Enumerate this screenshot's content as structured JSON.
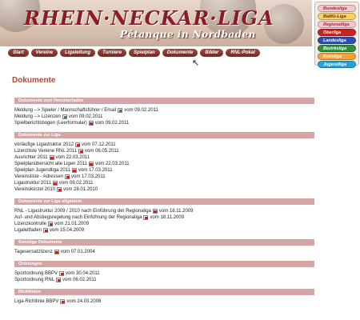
{
  "header": {
    "title": "RHEIN·NECKAR·LIGA",
    "subtitle": "Pétanque in Nordbaden"
  },
  "nav": [
    "Start",
    "Vereine",
    "Ligaleitung",
    "Turniere",
    "Spielplan",
    "Dokumente",
    "Bilder",
    "RNL-Pokal"
  ],
  "leagues": [
    {
      "label": "Bundesliga",
      "bg": "#f3c9cf",
      "color": "#b0243c"
    },
    {
      "label": "BaWü-Liga",
      "bg": "#f0d46a",
      "color": "#7a1b16"
    },
    {
      "label": "Regionalliga",
      "bg": "#f3c9cf",
      "color": "#b0243c"
    },
    {
      "label": "Oberliga",
      "bg": "#c9231f",
      "color": "#ffffff"
    },
    {
      "label": "Landesliga",
      "bg": "#2f4fb0",
      "color": "#ffffff"
    },
    {
      "label": "Bezirksliga",
      "bg": "#2f8f3a",
      "color": "#ffffff"
    },
    {
      "label": "Kreisliga",
      "bg": "#f3a33a",
      "color": "#ffffff"
    },
    {
      "label": "Jugendliga",
      "bg": "#2aa0d8",
      "color": "#ffffff"
    }
  ],
  "page_title": "Dokumente",
  "sections": [
    {
      "title": "Dokumente zum Herunterladen",
      "rows": [
        {
          "label": "Meldung --> Spieler / Mannschaftsführer / Email",
          "icon": "excel",
          "date": "vom 09.02.2011"
        },
        {
          "label": "Meldung --> Lizenzen",
          "icon": "excel",
          "date": "vom 09.02.2011"
        },
        {
          "label": "Spielberichtsbogen (Leerformular)",
          "icon": "pdf",
          "date": "vom 09.02.2011"
        }
      ]
    },
    {
      "title": "Dokumente zur Liga",
      "rows": [
        {
          "label": "vorläufige Ligastruktur 2012",
          "icon": "pdf",
          "date": "vom 07.12.2011"
        },
        {
          "label": "Lizenzliste Vereine RNL 2011",
          "icon": "pdf",
          "date": "vom 06.05.2011"
        },
        {
          "label": "Ausrichter 2011",
          "icon": "pdf",
          "date": "vom 22.03.2011"
        },
        {
          "label": "Spielplanübersicht alle Ligen 2011",
          "icon": "pdf",
          "date": "vom 22.03.2011"
        },
        {
          "label": "Spielplan Jugendliga 2011",
          "icon": "pdf",
          "date": "vom 17.03.2011"
        },
        {
          "label": "Vereinsliste - Adressen",
          "icon": "pdf",
          "date": "vom 17.03.2011"
        },
        {
          "label": "Ligastruktur 2011",
          "icon": "pdf",
          "date": "vom 09.02.2011"
        },
        {
          "label": "Vereinskürzel 2010",
          "icon": "pdf",
          "date": "vom 28.01.2010"
        }
      ]
    },
    {
      "title": "Dokumente zur Liga allgemein",
      "rows": [
        {
          "label": "RNL - Ligastruktur 2009 / 2010 nach Einführung der Regionaliga",
          "icon": "pdf",
          "date": "vom 18.11.2009"
        },
        {
          "label": "Auf- und Abstiegsregelung nach Einführung der Regionaliga",
          "icon": "pdf",
          "date": "vom 18.11.2009"
        },
        {
          "label": "Lizenzkontrolle",
          "icon": "pdf",
          "date": "vom 21.01.2009"
        },
        {
          "label": "Ligaleitfaden",
          "icon": "pdf",
          "date": "vom 15.04.2009"
        }
      ]
    },
    {
      "title": "Sonstige Dokumente",
      "rows": [
        {
          "label": "Tagesersatzlizenz",
          "icon": "pdf",
          "date": "vom 07.01.2004"
        }
      ]
    },
    {
      "title": "Ordnungen",
      "rows": [
        {
          "label": "Sportordnung BBPV",
          "icon": "pdf",
          "date": "vom 30.04.2011"
        },
        {
          "label": "Sportordnung RNL",
          "icon": "pdf",
          "date": "vom 06.02.2011"
        }
      ]
    },
    {
      "title": "Richtlinien",
      "rows": [
        {
          "label": "Liga-Richtlinie BBPV",
          "icon": "pdf",
          "date": "vom 24.03.2008"
        }
      ]
    }
  ]
}
